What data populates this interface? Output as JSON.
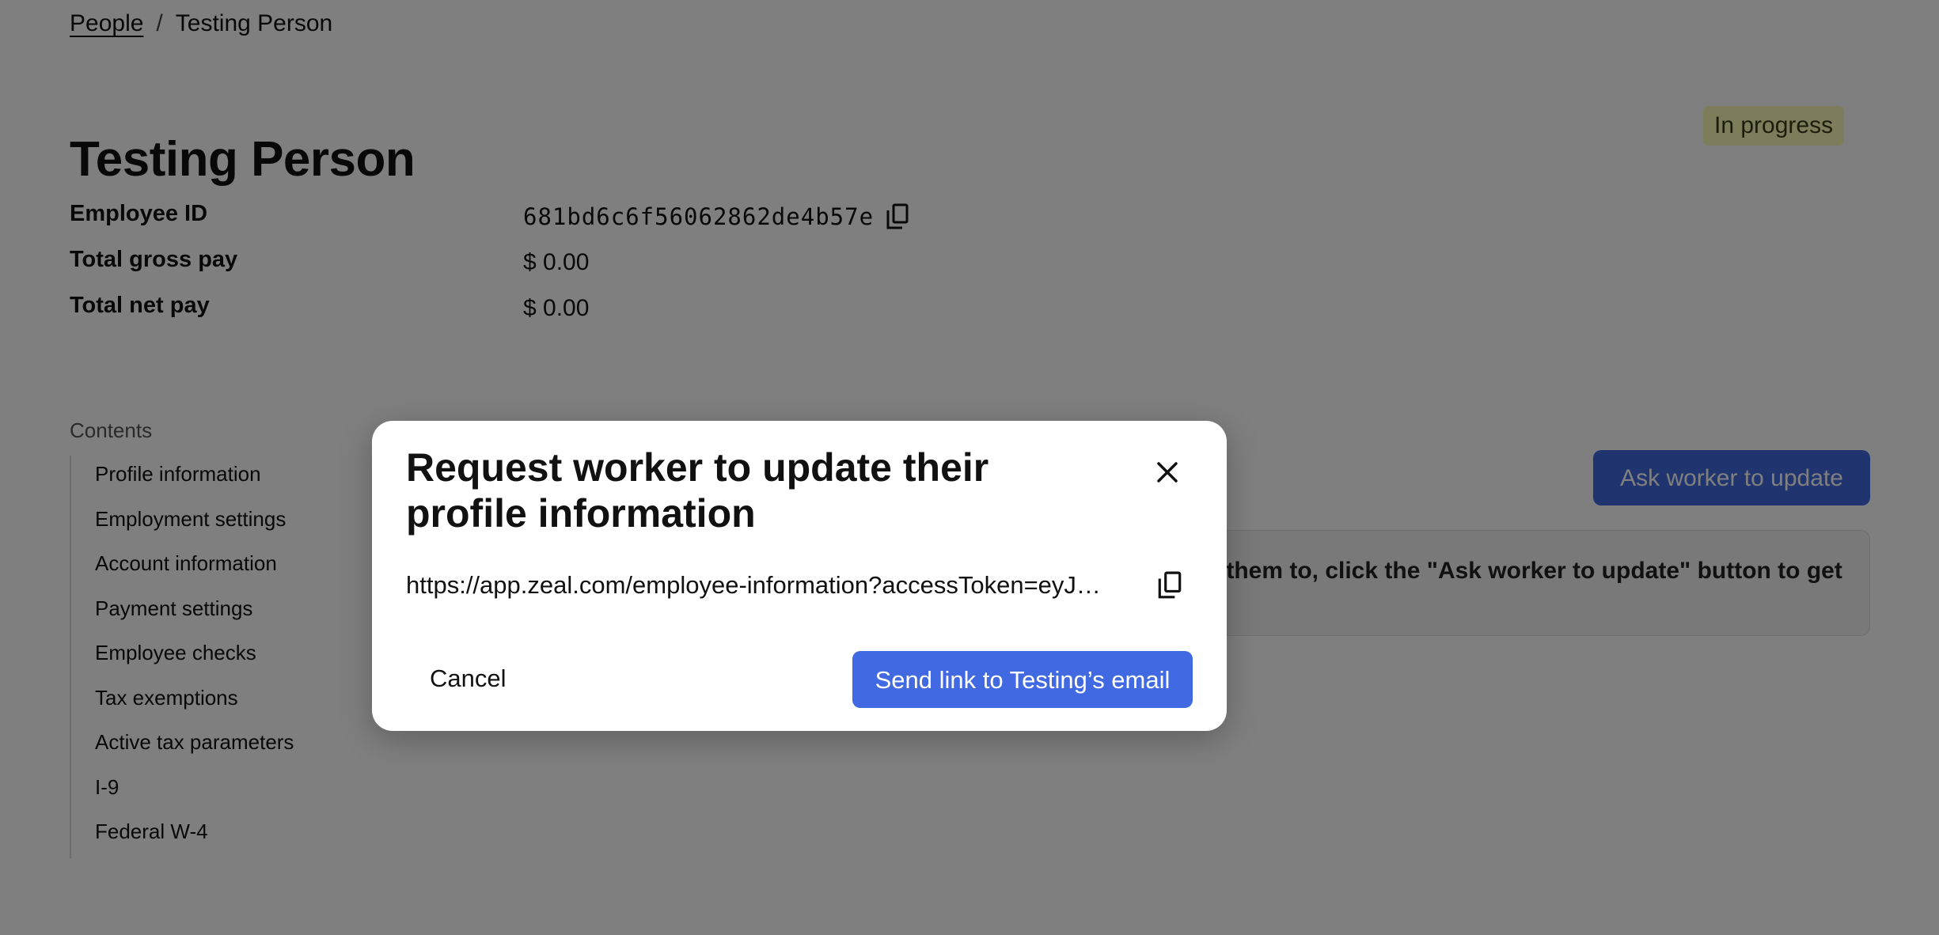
{
  "breadcrumb": {
    "parent": "People",
    "separator": "/",
    "current": "Testing Person"
  },
  "page": {
    "title": "Testing Person",
    "status": "In progress"
  },
  "details": {
    "employee_id": {
      "label": "Employee ID",
      "value": "681bd6c6f56062862de4b57e"
    },
    "total_gross_pay": {
      "label": "Total gross pay",
      "value": "$ 0.00"
    },
    "total_net_pay": {
      "label": "Total net pay",
      "value": "$ 0.00"
    }
  },
  "contents": {
    "heading": "Contents",
    "items": [
      "Profile information",
      "Employment settings",
      "Account information",
      "Payment settings",
      "Employee checks",
      "Tax exemptions",
      "Active tax parameters",
      "I-9",
      "Federal W-4"
    ]
  },
  "profile_section": {
    "ask_button_label": "Ask worker to update",
    "info_text": "t them to, click the \"Ask worker to update\" button to get"
  },
  "modal": {
    "title": "Request worker to update their profile information",
    "link": "https://app.zeal.com/employee-information?accessToken=eyJhb...",
    "cancel_label": "Cancel",
    "send_label": "Send link to Testing’s email"
  },
  "icons": {
    "copy": "copy-icon",
    "close": "close-icon"
  },
  "colors": {
    "accent": "#4169e1",
    "badge_bg": "#fbfbb6",
    "overlay": "rgba(0,0,0,0.5)"
  }
}
